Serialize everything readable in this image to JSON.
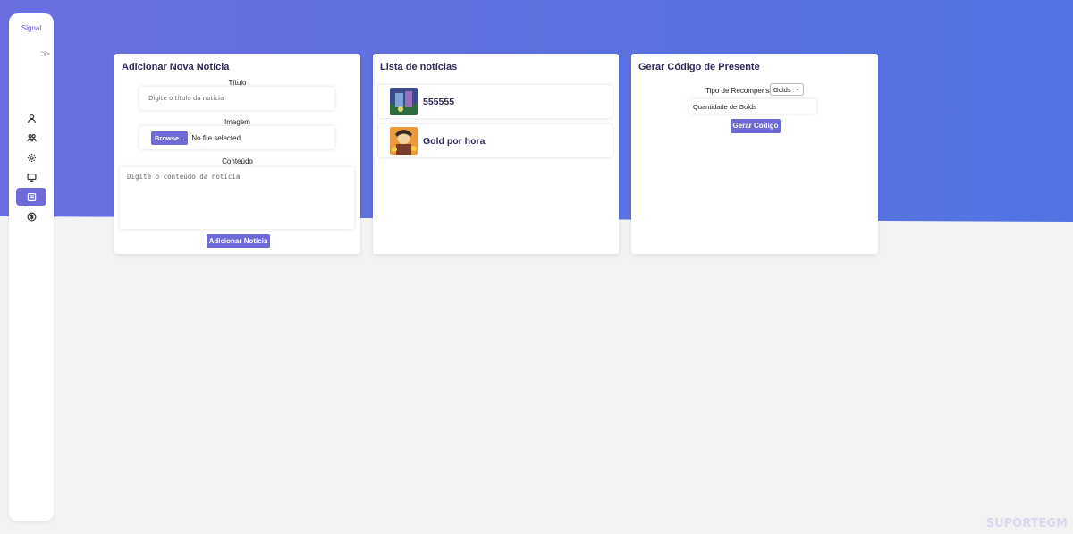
{
  "sidebar": {
    "brand": "Signal",
    "expand_icon": "double-chevron-right-icon",
    "items": [
      {
        "icon": "user-icon"
      },
      {
        "icon": "users-icon"
      },
      {
        "icon": "gear-icon"
      },
      {
        "icon": "monitor-icon"
      },
      {
        "icon": "news-icon",
        "active": true
      },
      {
        "icon": "dollar-icon"
      }
    ]
  },
  "add_news": {
    "title": "Adicionar Nova Notícia",
    "titulo_label": "Título",
    "titulo_placeholder": "Digite o título da notícia",
    "imagem_label": "Imagem",
    "browse_label": "Browse...",
    "file_status": "No file selected.",
    "conteudo_label": "Conteúdo",
    "conteudo_placeholder": "Digite o conteúdo da notícia",
    "submit_label": "Adicionar Notícia"
  },
  "news_list": {
    "title": "Lista de notícias",
    "items": [
      {
        "title": "555555"
      },
      {
        "title": "Gold por hora"
      }
    ]
  },
  "gift_code": {
    "title": "Gerar Código de Presente",
    "reward_type_label": "Tipo de Recompensa",
    "reward_type_value": "Golds",
    "quantity_placeholder": "Quantidade de Golds",
    "generate_label": "Gerar Código"
  },
  "watermark": "SUPORTEGM",
  "colors": {
    "accent": "#6d6ad8",
    "header_gradient_start": "#6b6fe0",
    "header_gradient_end": "#5174e2"
  }
}
